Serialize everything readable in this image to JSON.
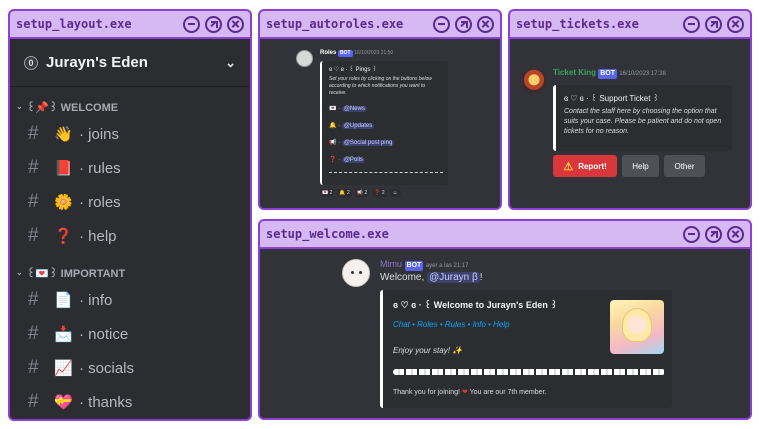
{
  "windows": {
    "layout": {
      "title": "setup_layout.exe"
    },
    "autoroles": {
      "title": "setup_autoroles.exe"
    },
    "tickets": {
      "title": "setup_tickets.exe"
    },
    "welcome": {
      "title": "setup_welcome.exe"
    }
  },
  "layout": {
    "server_name": "Jurayn's Eden",
    "server_icon": "0",
    "categories": [
      {
        "label": "꒰📌꒱ WELCOME",
        "channels": [
          {
            "emoji": "👋",
            "label": "· joins"
          },
          {
            "emoji": "📕",
            "label": "· rules"
          },
          {
            "emoji": "🌼",
            "label": "· roles"
          },
          {
            "emoji": "❓",
            "label": "· help"
          }
        ]
      },
      {
        "label": "꒰💌꒱ IMPORTANT",
        "channels": [
          {
            "emoji": "📄",
            "label": "· info"
          },
          {
            "emoji": "📩",
            "label": "· notice"
          },
          {
            "emoji": "📈",
            "label": "· socials"
          },
          {
            "emoji": "💝",
            "label": "· thanks"
          }
        ]
      }
    ]
  },
  "autoroles": {
    "author": "Roles",
    "bot_tag": "BOT",
    "timestamp": "16/10/2023 21:50",
    "embed_title": "ɞ ♡ ɞ · ꒰ Pings ꒱",
    "embed_desc": "Set your roles by clicking on the buttons below according to which notifications you want to receive.",
    "roles": [
      {
        "emoji": "💌",
        "mention": "@News"
      },
      {
        "emoji": "🔔",
        "mention": "@Updates"
      },
      {
        "emoji": "📢",
        "mention": "@Social post ping"
      },
      {
        "emoji": "❓",
        "mention": "@Polls"
      }
    ],
    "reactions": [
      {
        "emoji": "💌",
        "count": "2"
      },
      {
        "emoji": "🔔",
        "count": "2"
      },
      {
        "emoji": "📢",
        "count": "2"
      },
      {
        "emoji": "❓",
        "count": "2"
      }
    ]
  },
  "tickets": {
    "author": "Ticket King",
    "bot_tag": "BOT",
    "timestamp": "16/10/2023 17:38",
    "embed_title": "ɞ ♡ ɞ · ꒰ Support Ticket ꒱",
    "embed_desc": "Contact the staff here by choosing the option that suits your case. Please be patient and do not open tickets for no reason.",
    "buttons": {
      "report": "Report!",
      "help": "Help",
      "other": "Other"
    }
  },
  "welcome": {
    "author": "Mimu",
    "bot_tag": "BOT",
    "timestamp": "ayer a las 21:17",
    "greeting": "Welcome,",
    "mention": "@Jurayn β",
    "greeting_end": "!",
    "embed_title": "ɞ ♡ ɞ · ꒰ Welcome to Jurayn's Eden ꒱",
    "links": [
      "Chat",
      "Roles",
      "Rules",
      "Info",
      "Help"
    ],
    "enjoy": "Enjoy your stay!",
    "footer_a": "Thank you for joining!",
    "footer_b": "You are our 7th member."
  },
  "colors": {
    "accent": "#8e3fd4",
    "titlebar": "#d6b8f3",
    "discord_bg": "#313338",
    "embed_bg": "#2b2d31",
    "blurple": "#5865f2",
    "danger": "#da373c",
    "link": "#00a8fc"
  }
}
